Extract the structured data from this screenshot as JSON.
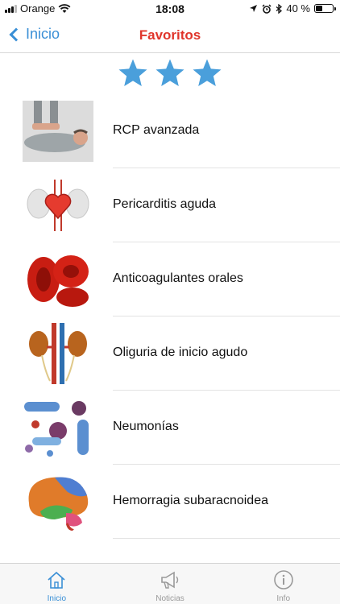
{
  "status_bar": {
    "carrier": "Orange",
    "time": "18:08",
    "battery": "40 %",
    "battery_level": 0.4
  },
  "nav": {
    "back_label": "Inicio",
    "title": "Favoritos"
  },
  "rating": {
    "stars": 3
  },
  "favorites": [
    {
      "label": "RCP avanzada",
      "icon": "cpr-illustration"
    },
    {
      "label": "Pericarditis aguda",
      "icon": "heart-pericardium-illustration"
    },
    {
      "label": "Anticoagulantes orales",
      "icon": "red-blood-cells-illustration"
    },
    {
      "label": "Oliguria de inicio agudo",
      "icon": "kidneys-illustration"
    },
    {
      "label": "Neumonías",
      "icon": "microbes-illustration"
    },
    {
      "label": "Hemorragia subaracnoidea",
      "icon": "brain-illustration"
    }
  ],
  "tabs": [
    {
      "label": "Inicio",
      "icon": "home-icon",
      "active": true
    },
    {
      "label": "Noticias",
      "icon": "megaphone-icon",
      "active": false
    },
    {
      "label": "Info",
      "icon": "info-icon",
      "active": false
    }
  ],
  "colors": {
    "accent": "#3a8fd6",
    "title_red": "#e0352b",
    "star_blue": "#4a9fdb"
  }
}
